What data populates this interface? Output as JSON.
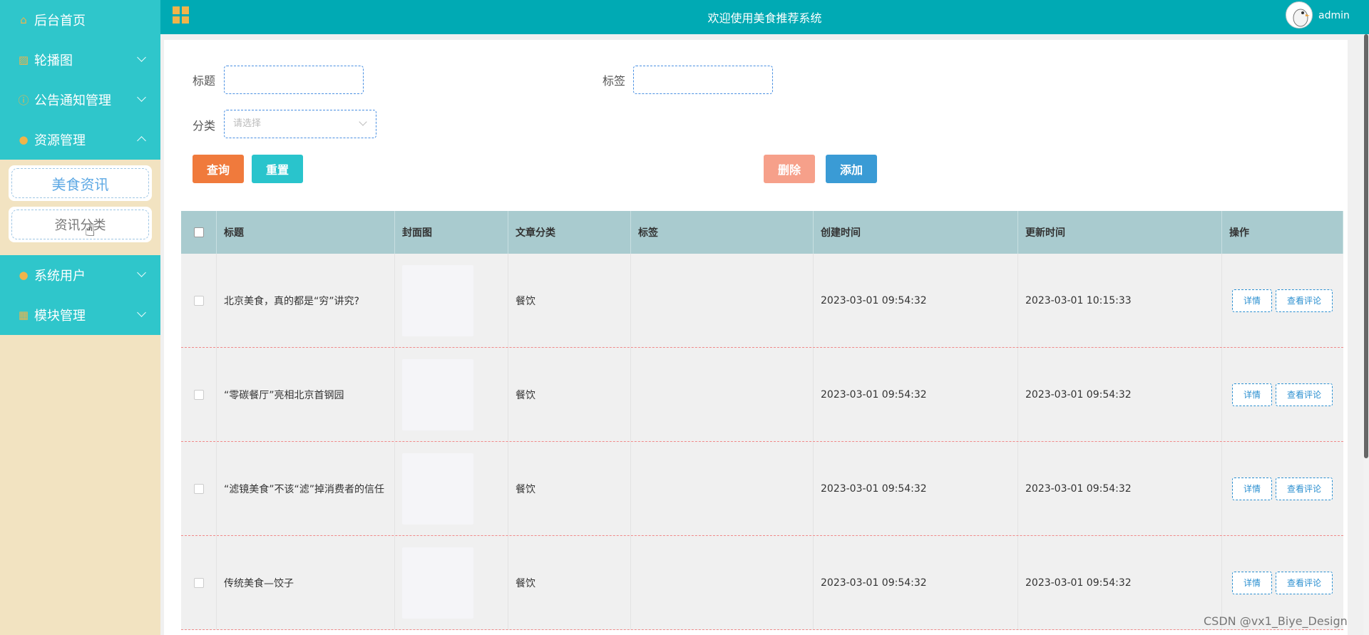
{
  "header": {
    "title": "欢迎使用美食推荐系统",
    "user": "admin"
  },
  "sidebar": {
    "items": [
      {
        "label": "后台首页",
        "icon": "home-icon"
      },
      {
        "label": "轮播图",
        "icon": "image-icon"
      },
      {
        "label": "公告通知管理",
        "icon": "info-icon"
      },
      {
        "label": "资源管理",
        "icon": "location-icon"
      },
      {
        "label": "系统用户",
        "icon": "user-icon"
      },
      {
        "label": "模块管理",
        "icon": "grid-icon"
      }
    ],
    "subitems": [
      {
        "label": "美食资讯"
      },
      {
        "label": "资讯分类"
      }
    ]
  },
  "search": {
    "title_label": "标题",
    "tag_label": "标签",
    "category_label": "分类",
    "category_placeholder": "请选择",
    "query": "查询",
    "reset": "重置",
    "delete": "删除",
    "add": "添加"
  },
  "table": {
    "headers": [
      "标题",
      "封面图",
      "文章分类",
      "标签",
      "创建时间",
      "更新时间",
      "操作"
    ],
    "rows": [
      {
        "title": "北京美食，真的都是“穷”讲究?",
        "category": "餐饮",
        "tag": "",
        "created": "2023-03-01 09:54:32",
        "updated": "2023-03-01 10:15:33"
      },
      {
        "title": "“零碳餐厅”亮相北京首钢园",
        "category": "餐饮",
        "tag": "",
        "created": "2023-03-01 09:54:32",
        "updated": "2023-03-01 09:54:32"
      },
      {
        "title": "“滤镜美食”不该“滤”掉消费者的信任",
        "category": "餐饮",
        "tag": "",
        "created": "2023-03-01 09:54:32",
        "updated": "2023-03-01 09:54:32"
      },
      {
        "title": "传统美食—饺子",
        "category": "餐饮",
        "tag": "",
        "created": "2023-03-01 09:54:32",
        "updated": "2023-03-01 09:54:32"
      }
    ],
    "detail": "详情",
    "comments": "查看评论"
  },
  "watermark": "CSDN @vx1_Biye_Design",
  "colors": {
    "sidebar": "#2fc6cb",
    "header": "#00aab4",
    "query": "#f07a3c",
    "reset": "#29c4cc",
    "delete": "#f6a08a",
    "add": "#3a9bd5"
  }
}
